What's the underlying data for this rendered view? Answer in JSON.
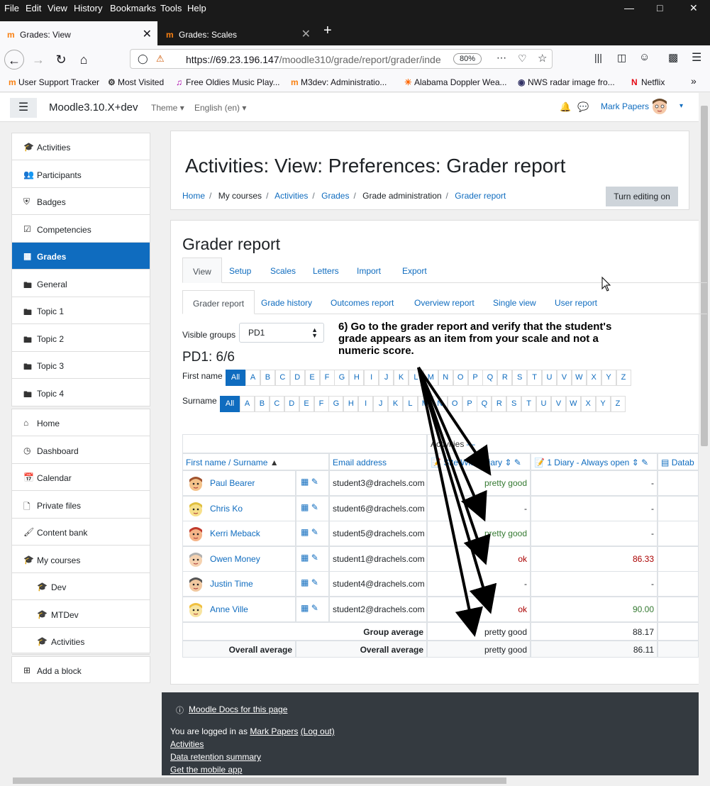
{
  "browser": {
    "menu": [
      "File",
      "Edit",
      "View",
      "History",
      "Bookmarks",
      "Tools",
      "Help"
    ],
    "tabs": [
      {
        "label": "Grades: View",
        "active": true
      },
      {
        "label": "Grades: Scales",
        "active": false
      }
    ],
    "url_host": "https://69.23.196.147",
    "url_path": "/moodle310/grade/report/grader/inde",
    "zoom": "80%",
    "bookmarks": [
      "User Support Tracker",
      "Most Visited",
      "Free Oldies Music Play...",
      "M3dev: Administratio...",
      "Alabama Doppler Wea...",
      "NWS radar image fro...",
      "Netflix"
    ]
  },
  "header": {
    "site_name": "Moodle3.10.X+dev",
    "theme_label": "Theme",
    "language_label": "English (en)",
    "user_name": "Mark Papers"
  },
  "drawer": {
    "course_items": [
      {
        "label": "Activities",
        "icon": "graduation-cap-icon"
      },
      {
        "label": "Participants",
        "icon": "users-icon"
      },
      {
        "label": "Badges",
        "icon": "shield-icon"
      },
      {
        "label": "Competencies",
        "icon": "check-square-icon"
      },
      {
        "label": "Grades",
        "icon": "table-icon",
        "active": true
      },
      {
        "label": "General",
        "icon": "folder-icon"
      },
      {
        "label": "Topic 1",
        "icon": "folder-icon"
      },
      {
        "label": "Topic 2",
        "icon": "folder-icon"
      },
      {
        "label": "Topic 3",
        "icon": "folder-icon"
      },
      {
        "label": "Topic 4",
        "icon": "folder-icon"
      }
    ],
    "site_items": [
      {
        "label": "Home",
        "icon": "home-icon"
      },
      {
        "label": "Dashboard",
        "icon": "dashboard-icon"
      },
      {
        "label": "Calendar",
        "icon": "calendar-icon"
      },
      {
        "label": "Private files",
        "icon": "file-icon"
      },
      {
        "label": "Content bank",
        "icon": "paint-brush-icon"
      },
      {
        "label": "My courses",
        "icon": "graduation-cap-icon"
      },
      {
        "label": "Dev",
        "icon": "graduation-cap-icon"
      },
      {
        "label": "MTDev",
        "icon": "graduation-cap-icon"
      },
      {
        "label": "Activities",
        "icon": "graduation-cap-icon"
      }
    ],
    "add_block": "Add a block"
  },
  "page": {
    "title": "Activities: View: Preferences: Grader report",
    "breadcrumb": [
      "Home",
      "My courses",
      "Activities",
      "Grades",
      "Grade administration",
      "Grader report"
    ],
    "edit_button": "Turn editing on",
    "report_title": "Grader report",
    "tabs_primary": [
      "View",
      "Setup",
      "Scales",
      "Letters",
      "Import",
      "Export"
    ],
    "tabs_secondary": [
      "Grader report",
      "Grade history",
      "Outcomes report",
      "Overview report",
      "Single view",
      "User report"
    ],
    "visible_groups_label": "Visible groups",
    "visible_groups_value": "PD1",
    "group_count": "PD1: 6/6",
    "first_name_label": "First name",
    "surname_label": "Surname",
    "all_label": "All",
    "letters": [
      "A",
      "B",
      "C",
      "D",
      "E",
      "F",
      "G",
      "H",
      "I",
      "J",
      "K",
      "L",
      "M",
      "N",
      "O",
      "P",
      "Q",
      "R",
      "S",
      "T",
      "U",
      "V",
      "W",
      "X",
      "Y",
      "Z"
    ]
  },
  "table": {
    "category_header": "Activities",
    "col_name": "First name / Surname",
    "col_email": "Email address",
    "col_site_diary": "Site Wide Diary",
    "col_diary1": "1 Diary - Always open",
    "col_datab": "Datab",
    "rows": [
      {
        "name": "Paul Bearer",
        "email": "student3@drachels.com",
        "site": "pretty good",
        "site_color": "green",
        "d1": "-",
        "d1_color": "plain"
      },
      {
        "name": "Chris Ko",
        "email": "student6@drachels.com",
        "site": "-",
        "site_color": "plain",
        "d1": "-",
        "d1_color": "plain"
      },
      {
        "name": "Kerri Meback",
        "email": "student5@drachels.com",
        "site": "pretty good",
        "site_color": "green",
        "d1": "-",
        "d1_color": "plain"
      },
      {
        "name": "Owen Money",
        "email": "student1@drachels.com",
        "site": "ok",
        "site_color": "red",
        "d1": "86.33",
        "d1_color": "red"
      },
      {
        "name": "Justin Time",
        "email": "student4@drachels.com",
        "site": "-",
        "site_color": "plain",
        "d1": "-",
        "d1_color": "plain"
      },
      {
        "name": "Anne Ville",
        "email": "student2@drachels.com",
        "site": "ok",
        "site_color": "red",
        "d1": "90.00",
        "d1_color": "green"
      }
    ],
    "group_avg_label": "Group average",
    "group_avg_site": "pretty good",
    "group_avg_d1": "88.17",
    "overall_avg_label": "Overall average",
    "overall_avg_site": "pretty good",
    "overall_avg_d1": "86.11"
  },
  "footer": {
    "docs_link": "Moodle Docs for this page",
    "logged_prefix": "You are logged in as ",
    "logged_user": "Mark Papers",
    "logout": "(Log out)",
    "links": [
      "Activities",
      "Data retention summary",
      "Get the mobile app"
    ]
  },
  "annotation": "6) Go to the grader report and verify that the student's grade appears as an item from your scale and not a numeric score."
}
